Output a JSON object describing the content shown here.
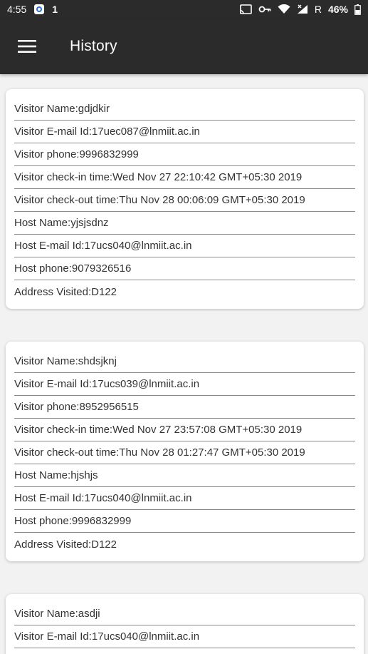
{
  "status_bar": {
    "time": "4:55",
    "notification_digit": "1",
    "roaming": "R",
    "battery": "46%"
  },
  "app_bar": {
    "title": "History"
  },
  "labels": {
    "visitor_name": "Visitor Name: ",
    "visitor_email": "Visitor E-mail Id: ",
    "visitor_phone": "Visitor phone: ",
    "checkin": "Visitor check-in time: ",
    "checkout": "Visitor check-out time: ",
    "host_name": "Host Name: ",
    "host_email": "Host E-mail Id: ",
    "host_phone": "Host phone: ",
    "address": "Address Visited: "
  },
  "records": [
    {
      "visitor_name": "gdjdkir",
      "visitor_email": "17uec087@lnmiit.ac.in",
      "visitor_phone": "9996832999",
      "checkin": "Wed Nov 27 22:10:42 GMT+05:30 2019",
      "checkout": "Thu Nov 28 00:06:09 GMT+05:30 2019",
      "host_name": "yjsjsdnz",
      "host_email": "17ucs040@lnmiit.ac.in",
      "host_phone": "9079326516",
      "address": "D122"
    },
    {
      "visitor_name": "shdsjknj",
      "visitor_email": "17ucs039@lnmiit.ac.in",
      "visitor_phone": "8952956515",
      "checkin": "Wed Nov 27 23:57:08 GMT+05:30 2019",
      "checkout": "Thu Nov 28 01:27:47 GMT+05:30 2019",
      "host_name": "hjshjs",
      "host_email": "17ucs040@lnmiit.ac.in",
      "host_phone": "9996832999",
      "address": "D122"
    },
    {
      "visitor_name": "asdji",
      "visitor_email": "17ucs040@lnmiit.ac.in"
    }
  ]
}
